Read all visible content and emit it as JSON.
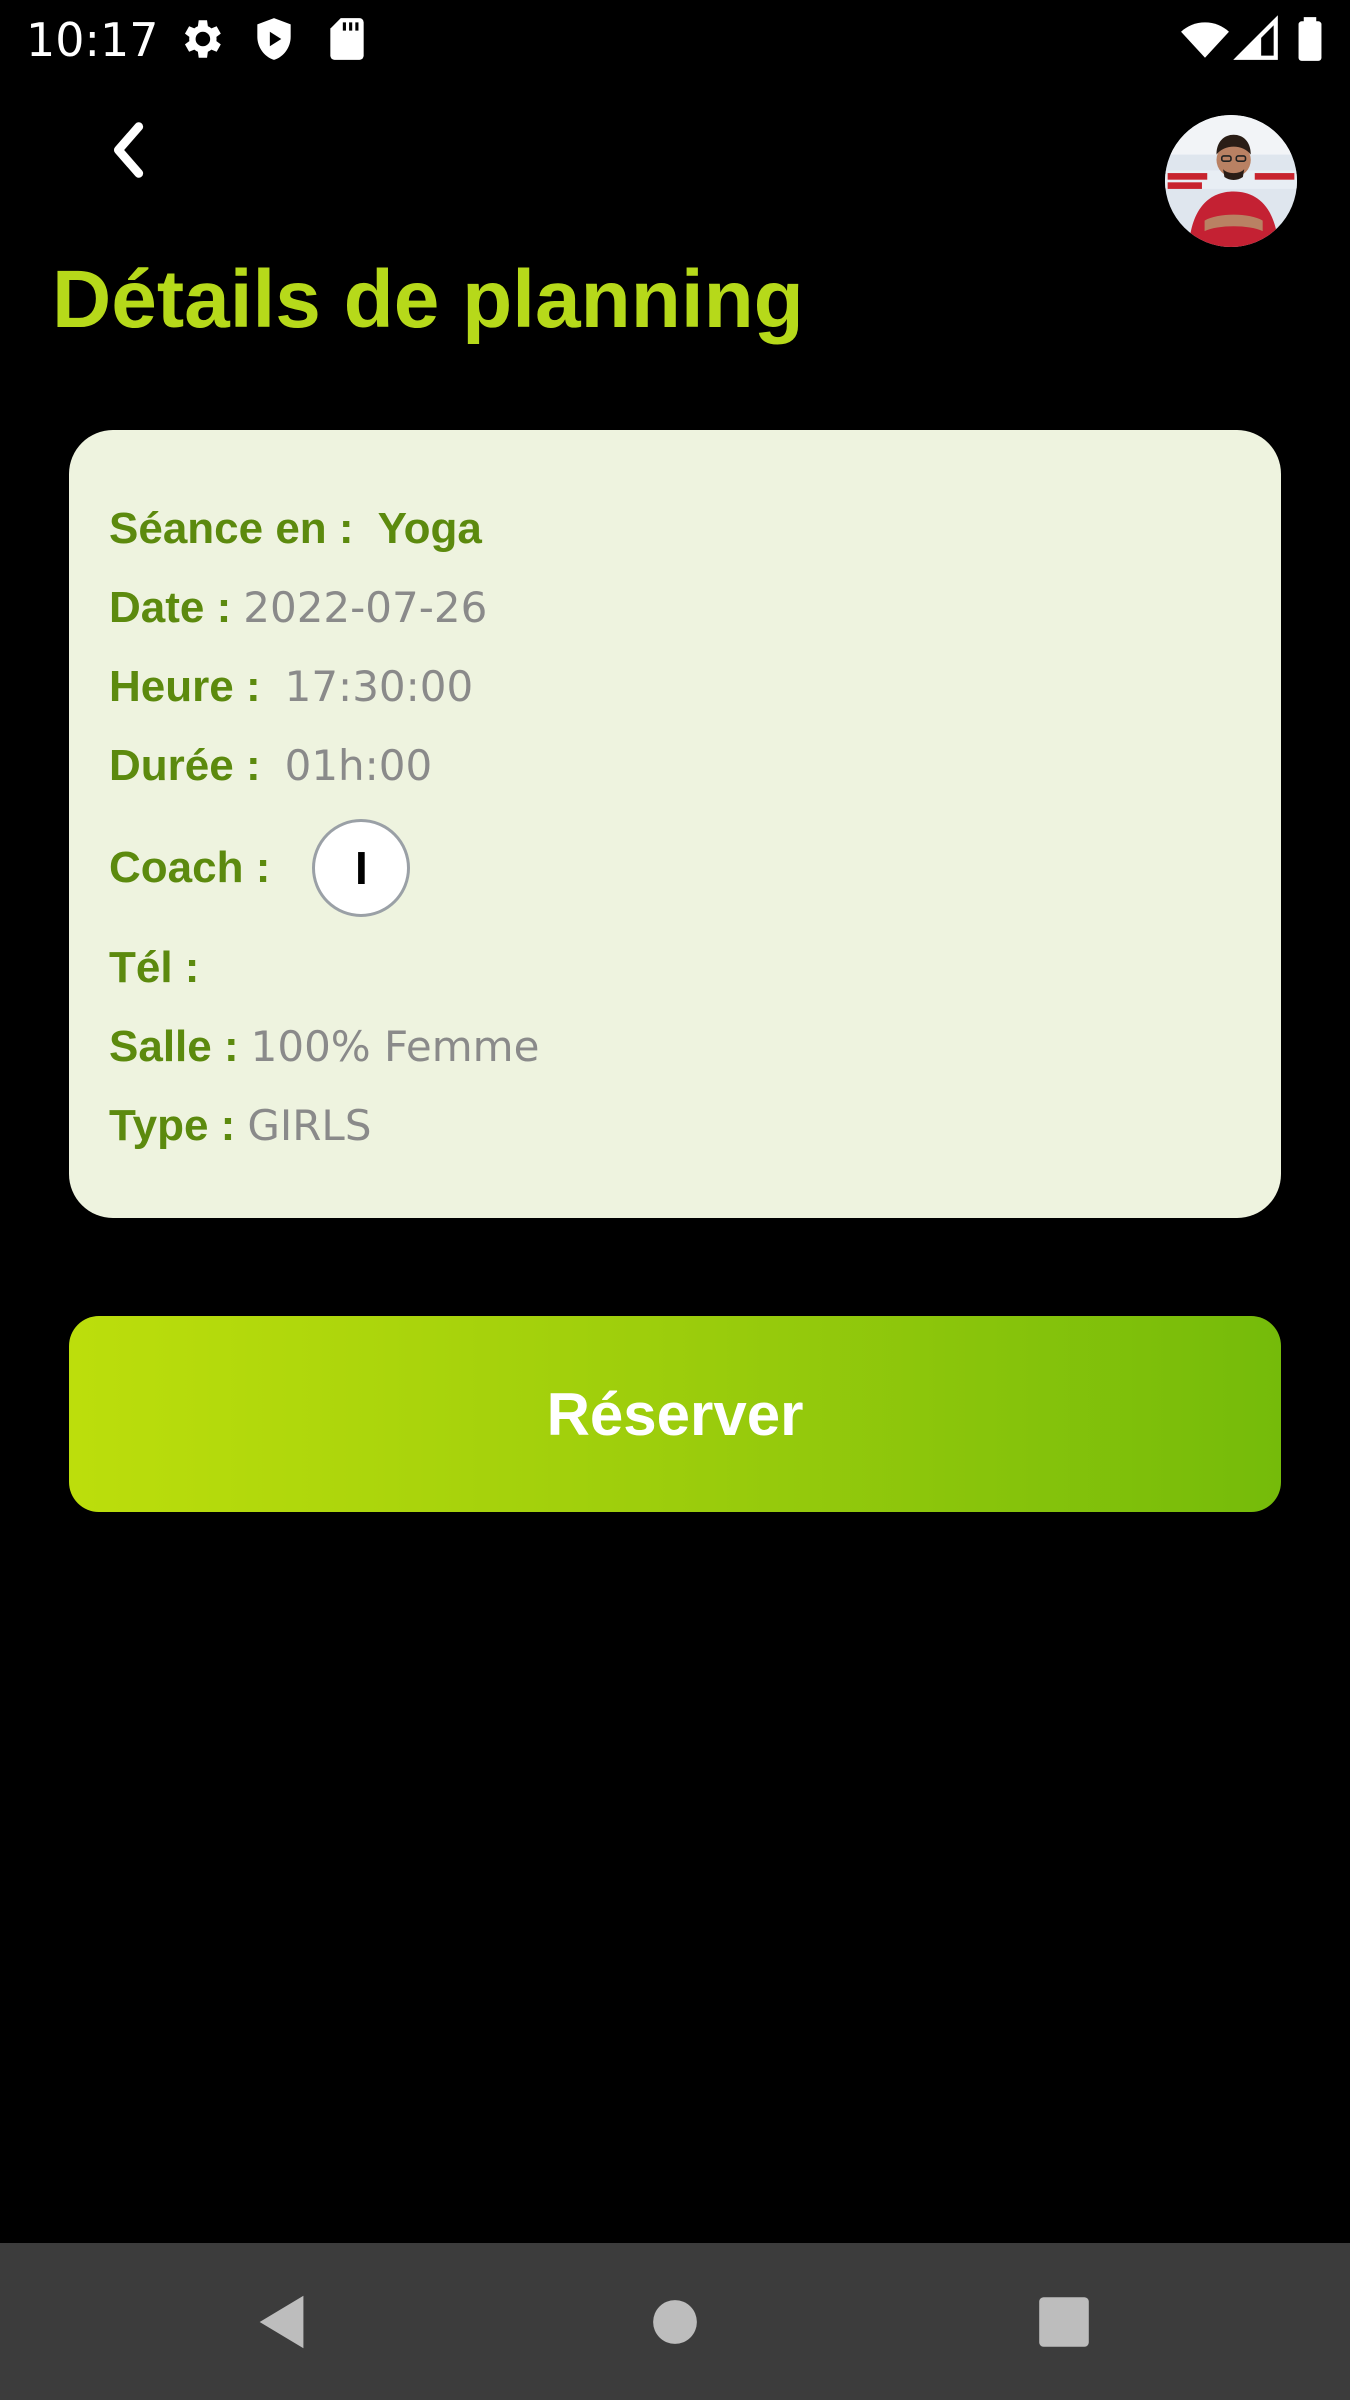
{
  "status_bar": {
    "time": "10:17",
    "left_icons": [
      "gear-icon",
      "shield-icon",
      "sd-card-icon"
    ],
    "right_icons": [
      "wifi-icon",
      "signal-icon",
      "battery-icon"
    ]
  },
  "header": {
    "back_icon": "back-arrow-icon",
    "profile_avatar": "profile-avatar",
    "title": "Détails de planning"
  },
  "details": {
    "seance_label": "Séance en :",
    "seance_value": "Yoga",
    "date_label": "Date :",
    "date_value": "2022-07-26",
    "heure_label": "Heure :",
    "heure_value": "17:30:00",
    "duree_label": "Durée :",
    "duree_value": "01h:00",
    "coach_label": "Coach :",
    "coach_initial": "I",
    "tel_label": "Tél :",
    "salle_label": "Salle :",
    "salle_value": "100% Femme",
    "type_label": "Type :",
    "type_value": "GIRLS"
  },
  "actions": {
    "reserve_label": "Réserver"
  },
  "nav_bar": {
    "buttons": [
      "back-triangle-icon",
      "home-circle-icon",
      "recents-square-icon"
    ]
  },
  "colors": {
    "background": "#000000",
    "title": "#b6d91a",
    "card_background": "#eef3df",
    "label_green": "#5c8a0e",
    "value_gray": "#8a8a8a",
    "button_gradient_start": "#bcde0c",
    "button_gradient_end": "#75bb0a",
    "nav_bar": "#3c3c3c"
  }
}
